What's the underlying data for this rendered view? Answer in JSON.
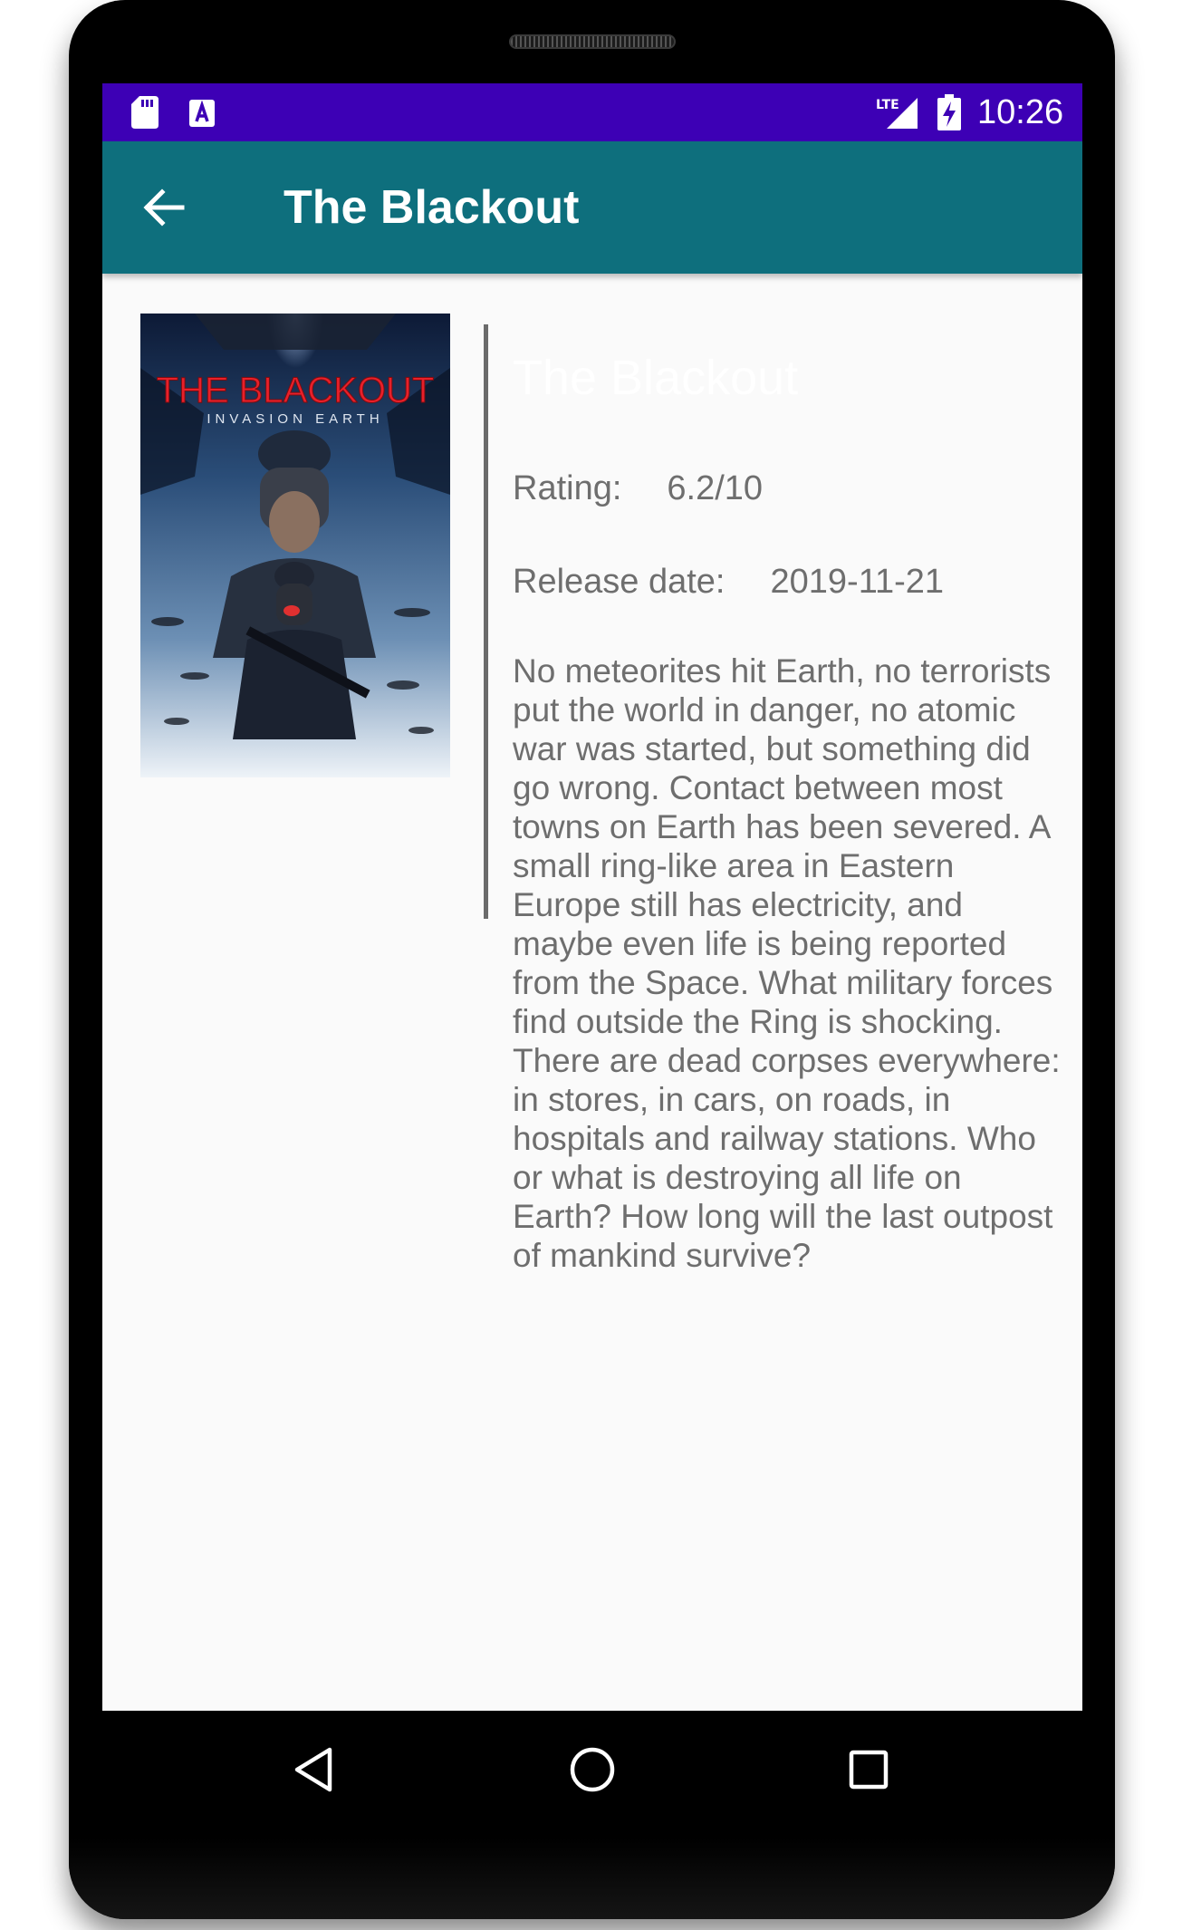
{
  "status_bar": {
    "time": "10:26",
    "icons": [
      "sd-card-icon",
      "a-notification-icon",
      "lte-signal-icon",
      "battery-charging-icon"
    ],
    "color": "#3d00b5"
  },
  "app_bar": {
    "title": "The Blackout",
    "back_icon": "arrow-back-icon",
    "color": "#0e6f7d"
  },
  "poster": {
    "title_text": "THE BLACKOUT",
    "subtitle_text": "INVASION EARTH"
  },
  "movie": {
    "title": "The Blackout",
    "rating_label": "Rating:",
    "rating_value": "6.2/10",
    "release_label": "Release date:",
    "release_value": "2019-11-21",
    "overview": "No meteorites hit Earth, no terrorists put the world in danger, no atomic war was started, but something did go wrong. Contact between most towns on Earth has been severed. A small ring-like area in Eastern Europe still has electricity, and maybe even life is being reported from the Space. What military forces find outside the Ring is shocking. There are dead corpses everywhere: in stores, in cars, on roads, in hospitals and railway stations. Who or what is destroying all life on Earth? How long will the last outpost of mankind survive?"
  },
  "nav_bar": {
    "icons": [
      "nav-back-icon",
      "nav-home-icon",
      "nav-recents-icon"
    ]
  }
}
